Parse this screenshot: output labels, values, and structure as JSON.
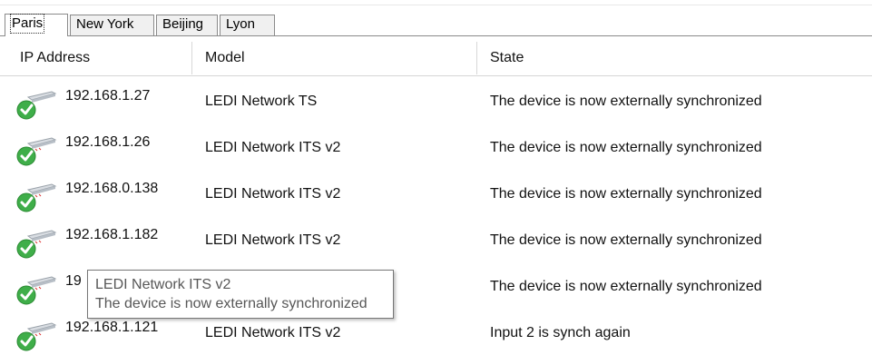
{
  "tabs": [
    "Paris",
    "New York",
    "Beijing",
    "Lyon"
  ],
  "active_tab": "Paris",
  "columns": {
    "ip": "IP Address",
    "model": "Model",
    "state": "State"
  },
  "rows": [
    {
      "ip": "192.168.1.27",
      "model": "LEDI Network TS",
      "state": "The device is now externally synchronized",
      "icon": "device-ok-icon"
    },
    {
      "ip": "192.168.1.26",
      "model": "LEDI Network ITS v2",
      "state": "The device is now externally synchronized",
      "icon": "device-ok-icon"
    },
    {
      "ip": "192.168.0.138",
      "model": "LEDI Network ITS v2",
      "state": "The device is now externally synchronized",
      "icon": "device-ok-icon"
    },
    {
      "ip": "192.168.1.182",
      "model": "LEDI Network ITS v2",
      "state": "The device is now externally synchronized",
      "icon": "device-ok-icon"
    },
    {
      "ip": "19",
      "model": "",
      "state": "The device is now externally synchronized",
      "icon": "device-ok-icon"
    },
    {
      "ip": "192.168.1.121",
      "model": "LEDI Network ITS v2",
      "state": "Input 2 is synch again",
      "icon": "device-ok-icon"
    }
  ],
  "tooltip": {
    "title": "LEDI Network ITS v2",
    "text": "The device is now externally synchronized"
  },
  "colors": {
    "check_green": "#3fae49",
    "grid_line": "#d5d5d5"
  }
}
